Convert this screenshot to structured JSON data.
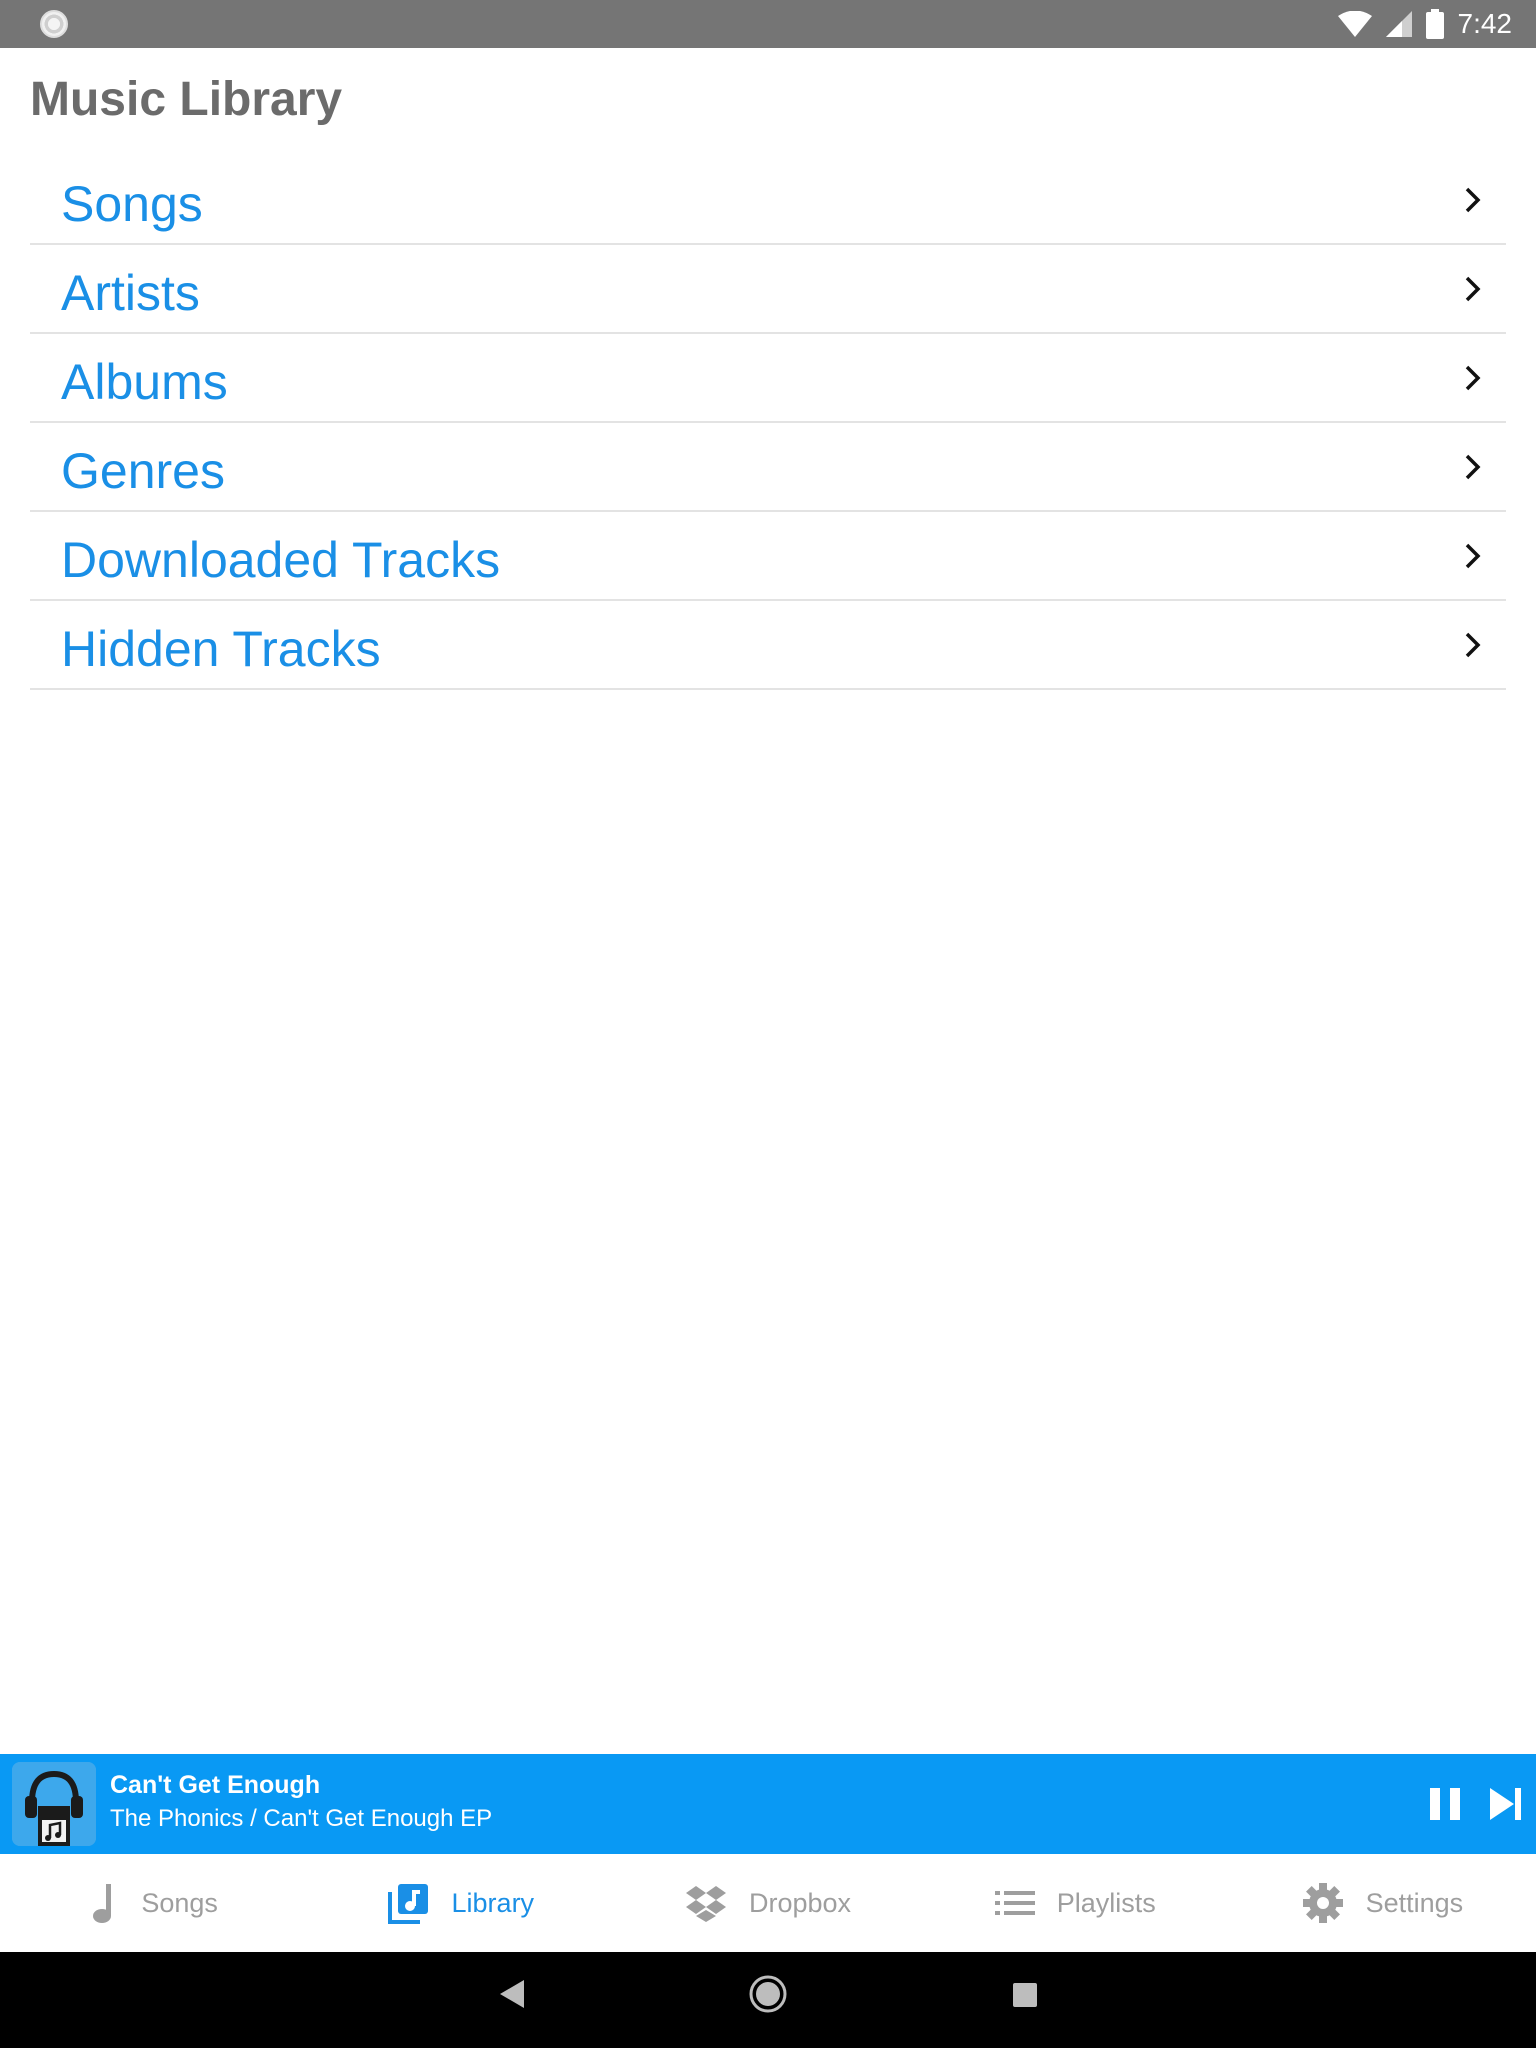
{
  "status_bar": {
    "time": "7:42",
    "icons": [
      "notification-icon",
      "wifi-icon",
      "signal-icon",
      "battery-icon"
    ]
  },
  "page": {
    "title": "Music Library"
  },
  "library": {
    "items": [
      {
        "label": "Songs"
      },
      {
        "label": "Artists"
      },
      {
        "label": "Albums"
      },
      {
        "label": "Genres"
      },
      {
        "label": "Downloaded Tracks"
      },
      {
        "label": "Hidden Tracks"
      }
    ]
  },
  "now_playing": {
    "title": "Can't Get Enough",
    "subtitle": "The Phonics / Can't Get Enough EP",
    "background_color": "#0999f4"
  },
  "tabs": [
    {
      "label": "Songs",
      "icon": "music-note-icon",
      "active": false
    },
    {
      "label": "Library",
      "icon": "library-icon",
      "active": true
    },
    {
      "label": "Dropbox",
      "icon": "dropbox-icon",
      "active": false
    },
    {
      "label": "Playlists",
      "icon": "list-icon",
      "active": false
    },
    {
      "label": "Settings",
      "icon": "gear-icon",
      "active": false
    }
  ],
  "colors": {
    "accent": "#1a8fe6",
    "title_gray": "#6b6b6b",
    "status_bar": "#757575",
    "inactive_tab": "#9e9e9e"
  }
}
